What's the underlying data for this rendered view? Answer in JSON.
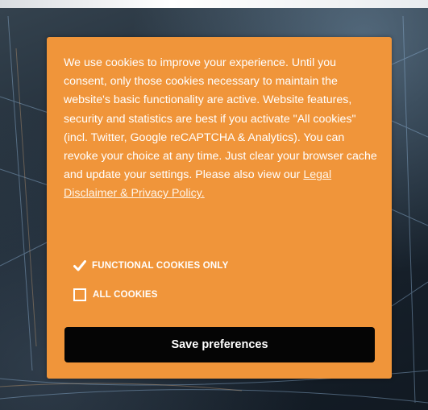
{
  "consent": {
    "message": "We use cookies to improve your experience. Until you consent, only those cookies necessary to maintain the website's basic functionality are active. Website features, security and statistics are best if you activate \"All cookies\" (incl. Twitter, Google reCAPTCHA & Analytics). You can revoke your choice at any time. Just clear your browser cache and update your settings. Please also view our",
    "policy_link": "Legal Disclaimer & Privacy Policy.",
    "options": [
      {
        "label": "FUNCTIONAL COOKIES ONLY",
        "checked": true
      },
      {
        "label": "ALL COOKIES",
        "checked": false
      }
    ],
    "save_label": "Save preferences"
  },
  "colors": {
    "modal_background": "#f0953a",
    "button_background": "#050505",
    "text": "#ffffff"
  }
}
